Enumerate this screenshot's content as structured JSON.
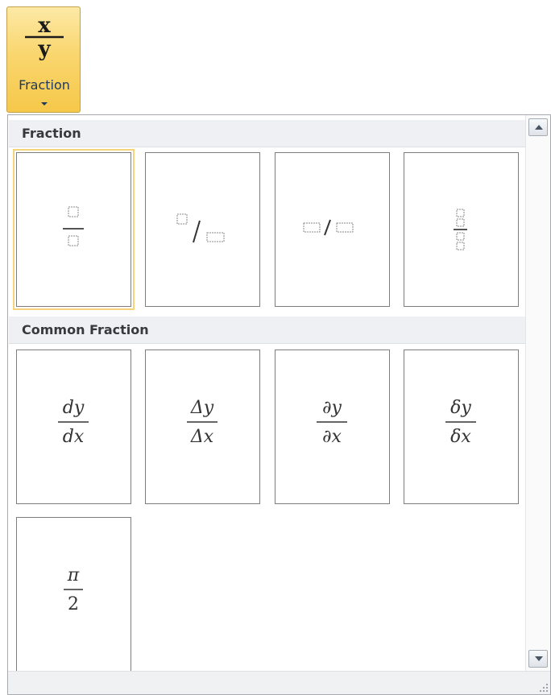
{
  "ribbon_button": {
    "label": "Fraction",
    "icon": "fraction-x-over-y-icon",
    "icon_numerator": "x",
    "icon_denominator": "y"
  },
  "gallery": {
    "sections": [
      {
        "title": "Fraction",
        "items": [
          {
            "name": "stacked-fraction",
            "icon": "stacked-fraction-icon"
          },
          {
            "name": "skewed-fraction",
            "icon": "skewed-fraction-icon"
          },
          {
            "name": "linear-fraction",
            "icon": "linear-fraction-icon"
          },
          {
            "name": "small-fraction",
            "icon": "small-fraction-icon"
          }
        ]
      },
      {
        "title": "Common Fraction",
        "items": [
          {
            "name": "dy-dx",
            "numerator": "dy",
            "denominator": "dx"
          },
          {
            "name": "delta-y-delta-x",
            "numerator": "Δy",
            "denominator": "Δx"
          },
          {
            "name": "partial-y-partial-x",
            "numerator": "∂y",
            "denominator": "∂x"
          },
          {
            "name": "small-delta-y-small-delta-x",
            "numerator": "δy",
            "denominator": "δx"
          },
          {
            "name": "pi-over-2",
            "numerator": "π",
            "denominator": "2"
          }
        ]
      }
    ]
  },
  "colors": {
    "ribbon_highlight": "#f9d66e",
    "selected_outline": "#f5d37a",
    "header_bg": "#eef0f3"
  }
}
